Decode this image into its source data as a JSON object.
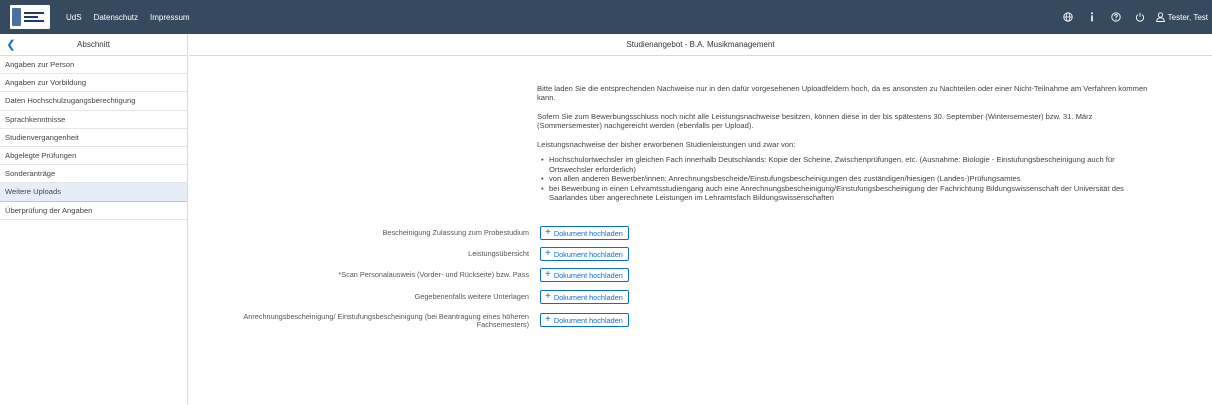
{
  "shell": {
    "nav": [
      "UdS",
      "Datenschutz",
      "Impressum"
    ],
    "user_name": "Tester, Test",
    "icons": [
      "globe-icon",
      "info-icon",
      "help-icon",
      "power-icon",
      "user-icon"
    ]
  },
  "sidebar": {
    "title": "Abschnitt",
    "items": [
      {
        "label": "Angaben zur Person"
      },
      {
        "label": "Angaben zur Vorbildung"
      },
      {
        "label": "Daten Hochschulzugangsberechtigung"
      },
      {
        "label": "Sprachkenntnisse"
      },
      {
        "label": "Studienvergangenheit"
      },
      {
        "label": "Abgelegte Prüfungen"
      },
      {
        "label": "Sonderanträge"
      },
      {
        "label": "Weitere Uploads",
        "active": true
      },
      {
        "label": "Überprüfung der Angaben"
      }
    ]
  },
  "main": {
    "title": "Studienangebot - B.A. Musikmanagement",
    "para1": "Bitte laden Sie die entsprechenden Nachweise nur in den dafür vorgesehenen Uploadfeldern hoch, da es ansonsten zu Nachteilen oder einer Nicht-Teilnahme am Verfahren kommen kann.",
    "para2": "Sofern Sie zum Bewerbungsschluss noch nicht alle Leistungsnachweise besitzen, können diese in der bis spätestens 30. September (Wintersemester) bzw. 31. März (Sommersemester) nachgereicht werden (ebenfalls per Upload).",
    "para3": "Leistungsnachweise der bisher erworbenen Studienleistungen und zwar von:",
    "bullets": [
      "Hochschulortwechsler im gleichen Fach innerhalb Deutschlands: Kopie der Scheine, Zwischenprüfungen, etc. (Ausnahme: Biologie - Einstufungsbescheinigung auch für Ortswechsler erforderlich)",
      "von allen anderen Bewerber/innen: Anrechnungsbescheide/Einstufungsbescheinigungen des zuständigen/hiesigen (Landes-)Prüfungsamtes",
      "bei Bewerbung in einen Lehramtsstudiengang auch eine Anrechnungsbescheinigung/Einstufungsbescheinigung der Fachrichtung Bildungswissenschaft der Universität des Saarlandes über angerechnete Leistungen im Lehramtsfach Bildungswissenschaften"
    ],
    "upload_button_label": "Dokument hochladen",
    "uploads": [
      {
        "label": "Bescheinigung Zulassung zum Probestudium"
      },
      {
        "label": "Leistungsübersicht"
      },
      {
        "label": "*Scan Personalausweis (Vorder- und Rückseite) bzw. Pass"
      },
      {
        "label": "Gegebenenfalls weitere Unterlagen"
      },
      {
        "label": "Anrechnungsbescheinigung/ Einstufungsbescheinigung (bei Beantragung eines höheren Fachsemesters)"
      }
    ]
  },
  "colors": {
    "shell_bg": "#354a5f",
    "accent": "#0a6ed1",
    "active_item_bg": "#e5eef8"
  }
}
